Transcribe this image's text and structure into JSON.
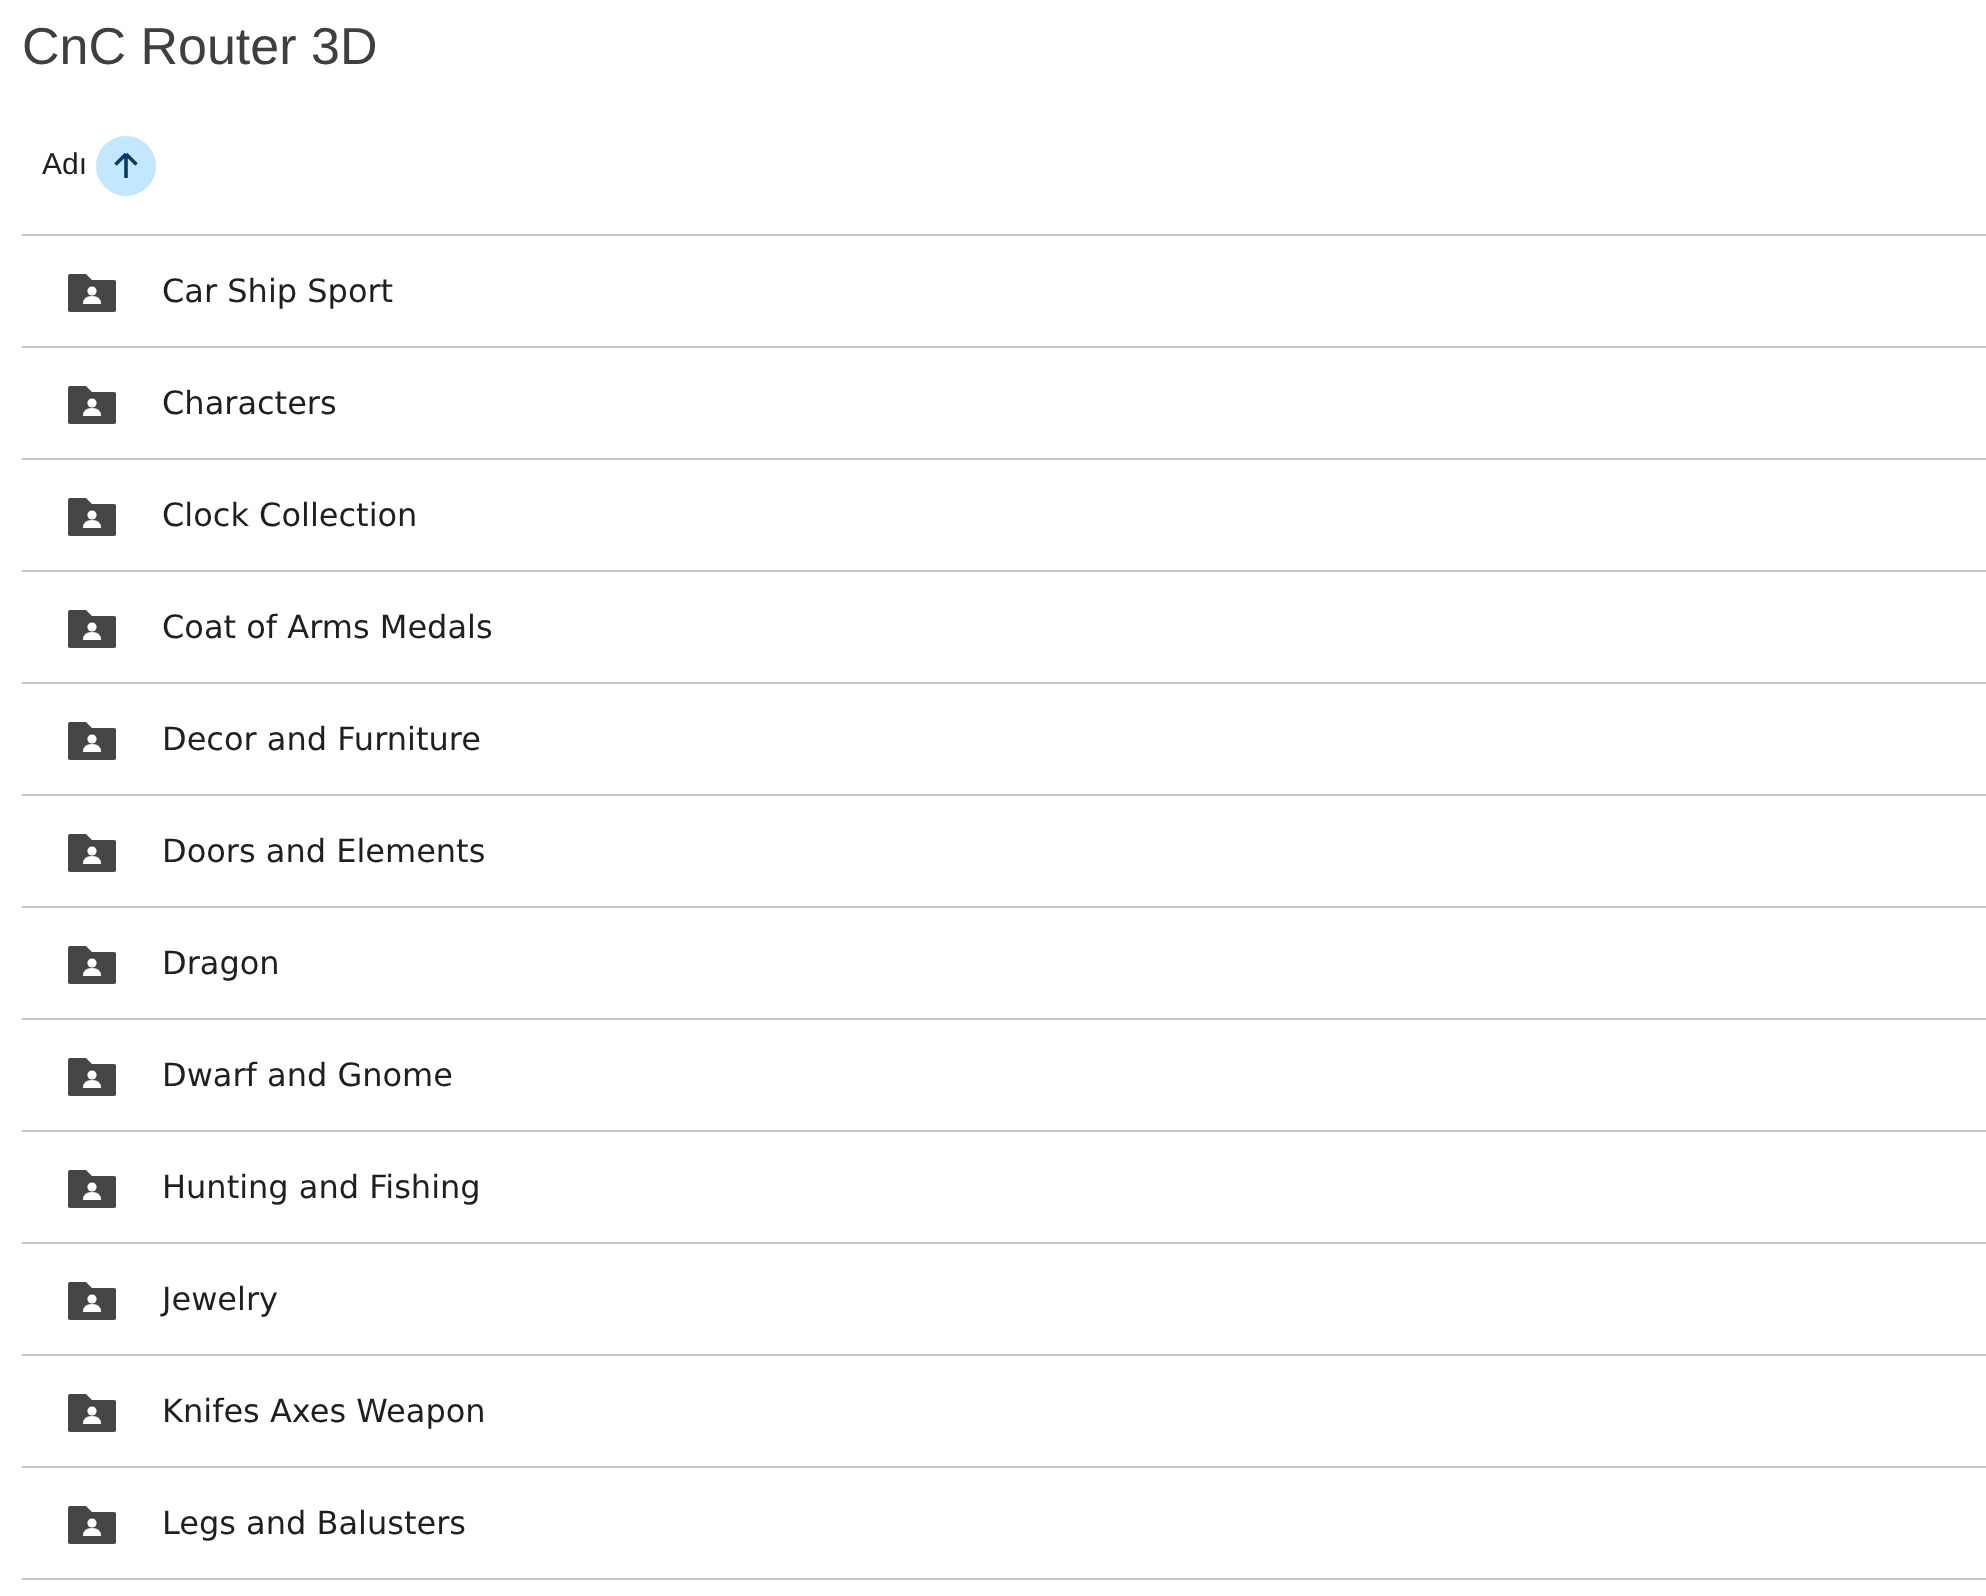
{
  "title": "CnC Router 3D",
  "table": {
    "columns": [
      {
        "label": "Adı",
        "sorted_ascending": true
      }
    ],
    "rows": [
      {
        "name": "Car Ship Sport"
      },
      {
        "name": "Characters"
      },
      {
        "name": "Clock Collection"
      },
      {
        "name": "Coat of Arms Medals"
      },
      {
        "name": "Decor and Furniture"
      },
      {
        "name": "Doors and Elements"
      },
      {
        "name": "Dragon"
      },
      {
        "name": "Dwarf and Gnome"
      },
      {
        "name": "Hunting and Fishing"
      },
      {
        "name": "Jewelry"
      },
      {
        "name": "Knifes Axes Weapon"
      },
      {
        "name": "Legs and Balusters"
      }
    ]
  }
}
